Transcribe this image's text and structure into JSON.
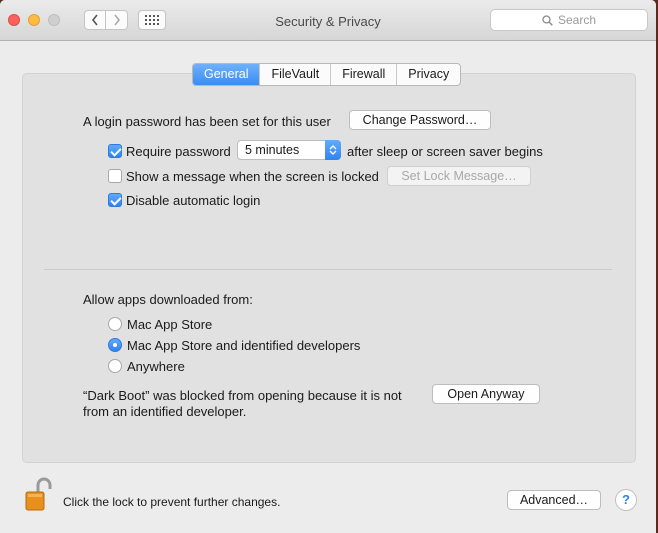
{
  "window": {
    "title": "Security & Privacy",
    "search_placeholder": "Search"
  },
  "tabs": [
    {
      "label": "General",
      "active": true
    },
    {
      "label": "FileVault",
      "active": false
    },
    {
      "label": "Firewall",
      "active": false
    },
    {
      "label": "Privacy",
      "active": false
    }
  ],
  "general": {
    "login_text": "A login password has been set for this user",
    "change_password_label": "Change Password…",
    "require_password_label": "Require password",
    "require_password_checked": true,
    "require_password_value": "5 minutes",
    "after_sleep_text": "after sleep or screen saver begins",
    "show_message_label": "Show a message when the screen is locked",
    "show_message_checked": false,
    "set_lock_message_label": "Set Lock Message…",
    "disable_autologin_label": "Disable automatic login",
    "disable_autologin_checked": true
  },
  "apps": {
    "heading": "Allow apps downloaded from:",
    "options": [
      {
        "label": "Mac App Store",
        "selected": false
      },
      {
        "label": "Mac App Store and identified developers",
        "selected": true
      },
      {
        "label": "Anywhere",
        "selected": false
      }
    ],
    "blocked_line1": "“Dark Boot” was blocked from opening because it is not",
    "blocked_line2": "from an identified developer.",
    "open_anyway_label": "Open Anyway"
  },
  "footer": {
    "lock_text": "Click the lock to prevent further changes.",
    "advanced_label": "Advanced…",
    "help_label": "?"
  },
  "colors": {
    "accent": "#3a8cf4",
    "lock": "#e8901e"
  }
}
